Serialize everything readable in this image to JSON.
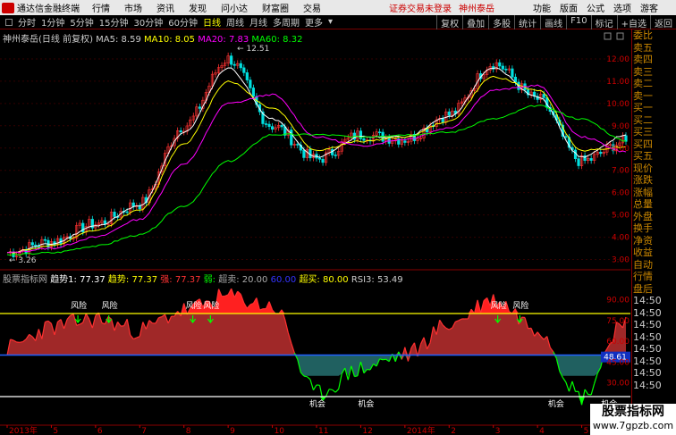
{
  "menubar": {
    "app_title": "通达信金融终端",
    "items": [
      "行情",
      "市场",
      "资讯",
      "发现",
      "问小达",
      "财富圈",
      "交易"
    ],
    "notice": "证券交易未登录",
    "stock": "神州泰岳",
    "right_items": [
      "功能",
      "版面",
      "公式",
      "选项",
      "游客"
    ]
  },
  "toolbar": {
    "periods": [
      "分时",
      "1分钟",
      "5分钟",
      "15分钟",
      "30分钟",
      "60分钟",
      "日线",
      "周线",
      "月线",
      "多周期",
      "更多"
    ],
    "active_period": "日线",
    "right_items": [
      "复权",
      "叠加",
      "多股",
      "统计",
      "画线",
      "F10",
      "标记",
      "+自选",
      "返回"
    ]
  },
  "chart_info": {
    "stock_label": "神州泰岳(日线 前复权)",
    "ma5": "MA5: 8.59",
    "ma10": "MA10: 8.05",
    "ma20": "MA20: 7.83",
    "ma60": "MA60: 8.32",
    "colors": {
      "ma5": "#ffffff",
      "ma10": "#ffff00",
      "ma20": "#ff00ff",
      "ma60": "#00ff00"
    }
  },
  "price_labels": {
    "high": "12.51",
    "low": "3.26"
  },
  "right_panel": {
    "items": [
      "委比",
      "卖五",
      "卖四",
      "卖三",
      "卖二",
      "卖一",
      "买一",
      "买二",
      "买三",
      "买四",
      "买五",
      "现价",
      "涨跌",
      "涨幅",
      "总量",
      "外盘",
      "换手",
      "净资",
      "收益",
      "自动",
      "行情",
      "盘后",
      "14:50",
      "14:50",
      "14:50",
      "14:50",
      "14:50",
      "14:50",
      "14:50",
      "14:50"
    ]
  },
  "indicator_info": {
    "name": "股票指标网",
    "trend1": "趋势1: 77.37",
    "trend": "趋势: 77.37",
    "red_label": "强: 77.37",
    "green_label": "弱: ",
    "oversold": "超卖: 20.00",
    "blue_label": "60.00",
    "overbought": "超买: 80.00",
    "rsi3": "RSI3: 53.49"
  },
  "indicator_labels": {
    "risk": "风险",
    "opportunity": "机会",
    "current": "48.61"
  },
  "watermark": {
    "line1": "股票指标网",
    "line2": "www.7gpzb.com"
  },
  "dates": [
    "2013年",
    "5",
    "6",
    "7",
    "8",
    "9",
    "10",
    "11",
    "12",
    "2014年",
    "2",
    "3",
    "4",
    "5",
    "6"
  ],
  "chart_data": [
    {
      "type": "line",
      "title": "神州泰岳(日线 前复权)",
      "ylabels": [
        "12.00",
        "11.00",
        "10.00",
        "9.00",
        "8.00",
        "7.00",
        "6.00",
        "5.00",
        "4.00",
        "3.00"
      ],
      "ylim": [
        2.7,
        12.8
      ],
      "x": [
        "2013-04",
        "2013-05",
        "2013-06",
        "2013-07",
        "2013-08",
        "2013-09",
        "2013-10",
        "2013-11",
        "2013-12",
        "2014-01",
        "2014-02",
        "2014-03",
        "2014-04",
        "2014-05",
        "2014-06"
      ],
      "series": [
        {
          "name": "Close",
          "values": [
            3.3,
            3.8,
            4.6,
            5.5,
            9.0,
            12.0,
            9.0,
            7.5,
            8.6,
            8.4,
            9.5,
            11.8,
            10.2,
            7.4,
            8.3
          ]
        },
        {
          "name": "MA5",
          "values": [
            3.3,
            3.7,
            4.5,
            5.4,
            8.7,
            11.6,
            9.3,
            7.6,
            8.5,
            8.5,
            9.4,
            11.6,
            10.3,
            7.6,
            8.59
          ]
        },
        {
          "name": "MA10",
          "values": [
            3.3,
            3.6,
            4.3,
            5.2,
            8.2,
            11.0,
            9.8,
            7.9,
            8.3,
            8.5,
            9.2,
            11.2,
            10.6,
            7.9,
            8.05
          ]
        },
        {
          "name": "MA20",
          "values": [
            3.3,
            3.5,
            4.0,
            4.8,
            7.3,
            10.0,
            10.4,
            8.5,
            8.1,
            8.4,
            8.9,
            10.6,
            10.8,
            8.5,
            7.83
          ]
        },
        {
          "name": "MA60",
          "values": [
            3.2,
            3.3,
            3.6,
            4.1,
            5.4,
            7.4,
            8.6,
            8.6,
            8.5,
            8.6,
            8.7,
            9.3,
            9.9,
            9.3,
            8.32
          ]
        }
      ]
    },
    {
      "type": "area",
      "title": "股票指标网",
      "ylabels": [
        "90.00",
        "75.00",
        "60.00",
        "45.00",
        "30.00"
      ],
      "ylim": [
        0,
        100
      ],
      "x": [
        "2013-04",
        "2013-05",
        "2013-06",
        "2013-07",
        "2013-08",
        "2013-09",
        "2013-10",
        "2013-11",
        "2013-12",
        "2014-01",
        "2014-02",
        "2014-03",
        "2014-04",
        "2014-05",
        "2014-06"
      ],
      "series": [
        {
          "name": "趋势",
          "values": [
            55,
            70,
            76,
            68,
            82,
            92,
            85,
            22,
            40,
            50,
            72,
            90,
            70,
            20,
            77.37
          ]
        }
      ],
      "thresholds": {
        "overbought": 80,
        "oversold": 20,
        "mid": 50
      }
    }
  ]
}
